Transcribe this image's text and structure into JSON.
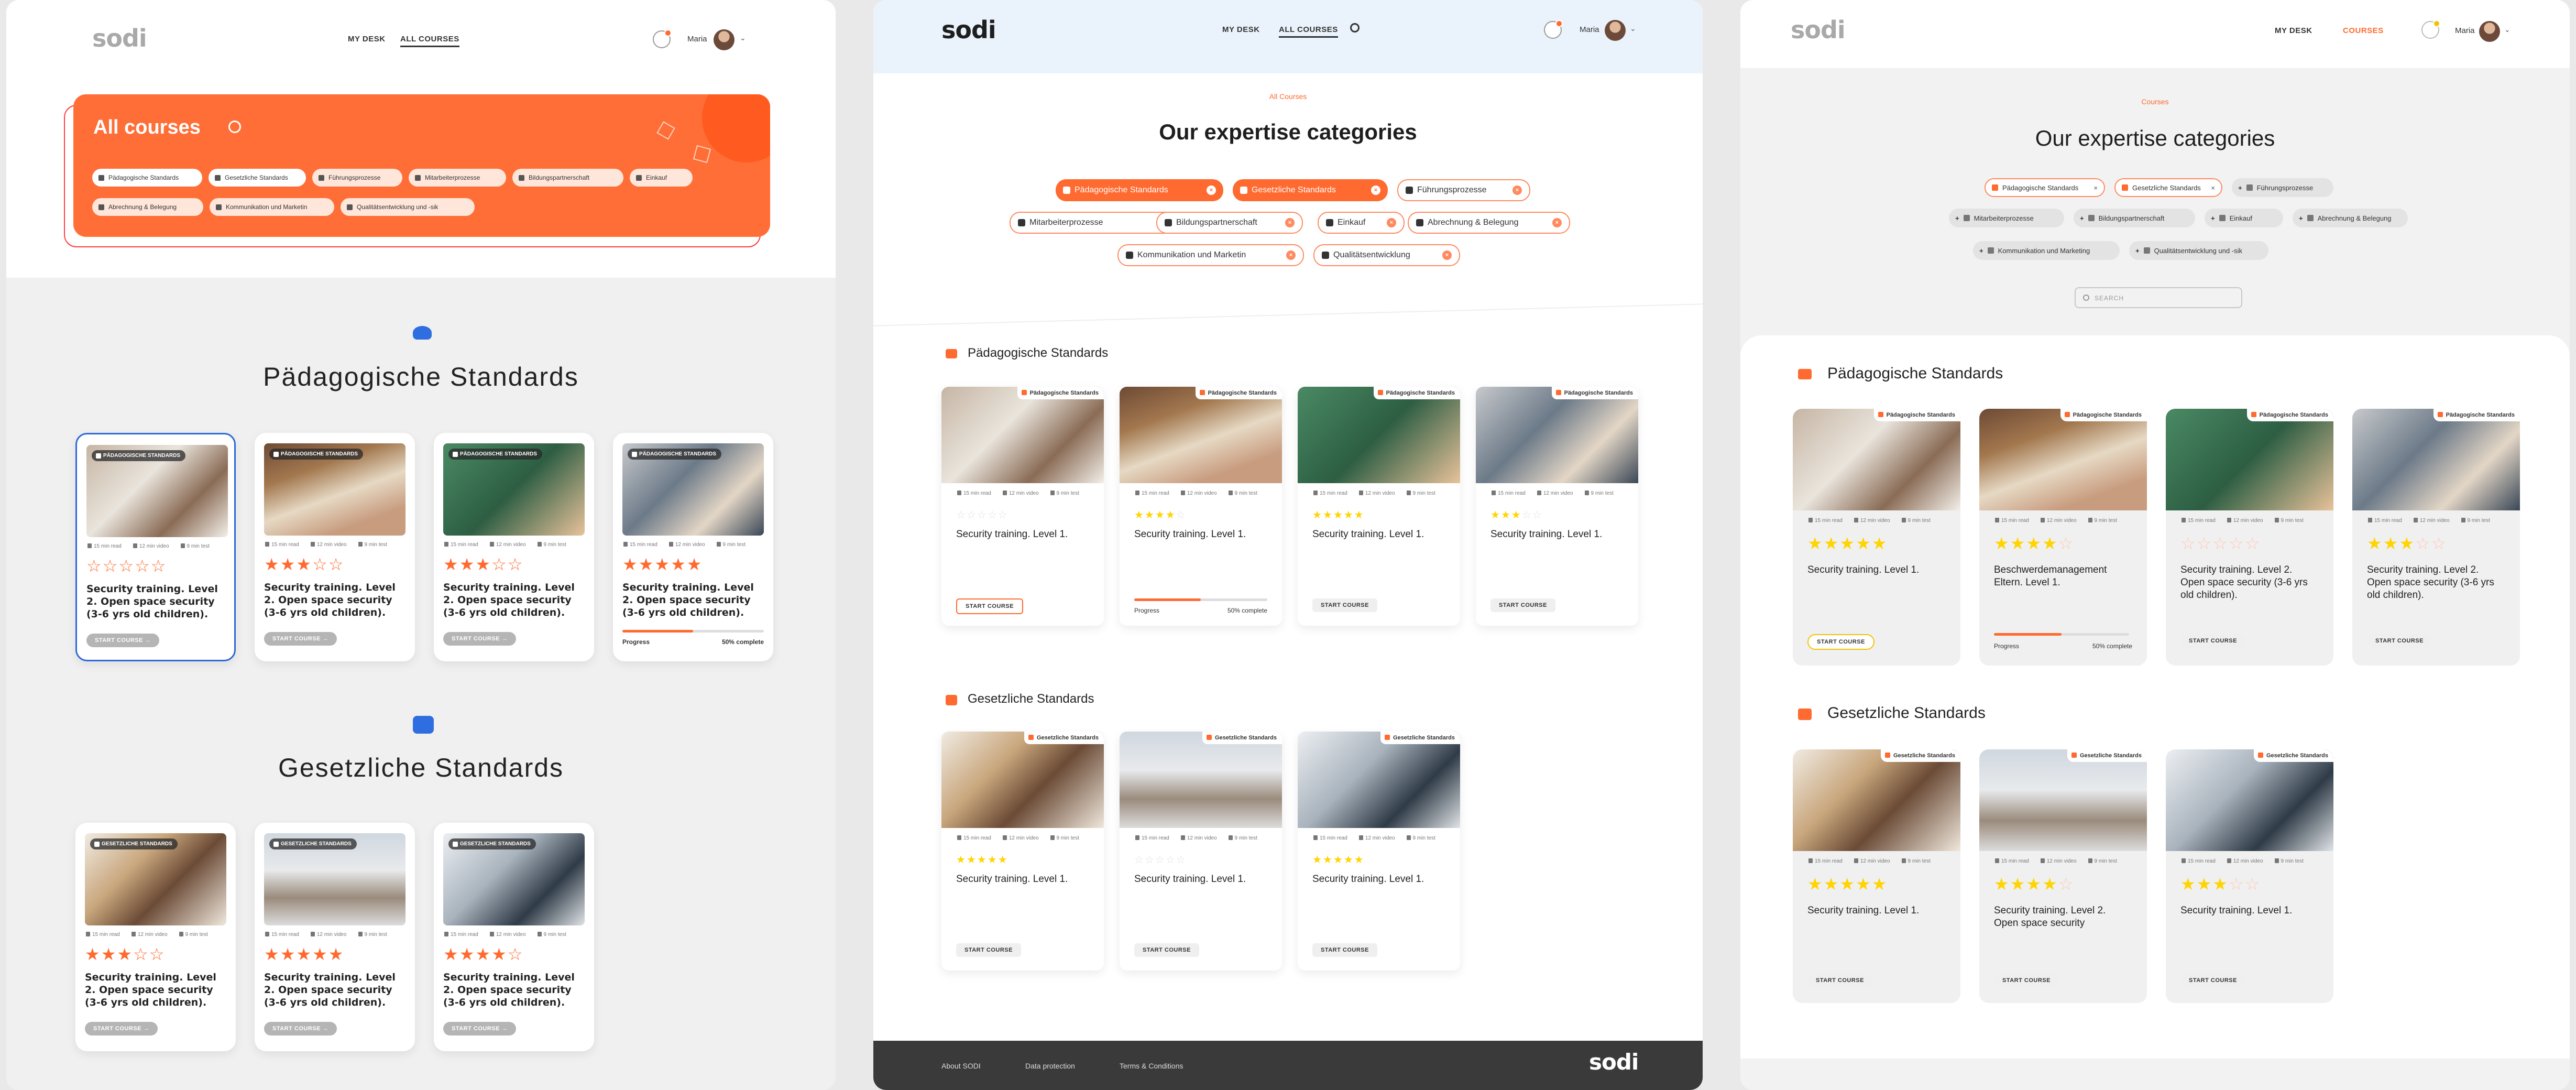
{
  "colors": {
    "accent": "#ff6a30",
    "star": "#ffd400",
    "selected": "#2d6ad8"
  },
  "panel1": {
    "logo": "sodi",
    "nav": {
      "my_desk": "MY DESK",
      "all_courses": "ALL COURSES"
    },
    "user": "Maria",
    "hero": {
      "title": "All courses",
      "chips": [
        "Pädagogische Standards",
        "Gesetzliche Standards",
        "Führungsprozesse",
        "Mitarbeiterprozesse",
        "Bildungspartnerschaft",
        "Einkauf",
        "Abrechnung & Belegung",
        "Kommunikation und Marketin",
        "Qualitätsentwicklung und -sik"
      ]
    },
    "section1": {
      "title": "Pädagogische Standards",
      "tag": "PÄDAGOGISCHE STANDARDS"
    },
    "section2": {
      "title": "Gesetzliche Standards",
      "tag": "GESETZLICHE STANDARDS"
    },
    "meta": {
      "read": "15 min read",
      "video": "12 min video",
      "test": "9 min test"
    },
    "course_title": "Security training. Level 2. Open space security (3-6 yrs old children).",
    "start": "START COURSE",
    "progress_label": "Progress",
    "progress_text": "50% complete",
    "progress_value": 0.5,
    "ratings1": [
      0,
      3,
      3,
      5
    ],
    "ratings2": [
      3,
      5,
      4
    ]
  },
  "panel2": {
    "logo": "sodi",
    "nav": {
      "my_desk": "MY DESK",
      "all_courses": "ALL COURSES"
    },
    "user": "Maria",
    "eyebrow": "All Courses",
    "heading": "Our expertise categories",
    "pills": [
      "Pädagogische Standards",
      "Gesetzliche Standards",
      "Führungsprozesse",
      "Mitarbeiterprozesse",
      "Bildungspartnerschaft",
      "Einkauf",
      "Abrechnung & Belegung",
      "Kommunikation und Marketin",
      "Qualitätsentwicklung"
    ],
    "section1": {
      "title": "Pädagogische Standards",
      "tag": "Pädagogische Standards"
    },
    "section2": {
      "title": "Gesetzliche Standards",
      "tag": "Gesetzliche Standards"
    },
    "meta": {
      "read": "15 min read",
      "video": "12 min video",
      "test": "9 min test"
    },
    "course_title": "Security training. Level 1.",
    "start": "START COURSE",
    "progress_label": "Progress",
    "progress_text": "50% complete",
    "progress_value": 0.5,
    "ratings1": [
      0,
      4,
      5,
      3
    ],
    "ratings2": [
      5,
      0,
      5
    ],
    "footer": {
      "about": "About SODI",
      "privacy": "Data protection",
      "terms": "Terms & Conditions",
      "logo": "sodi"
    }
  },
  "panel3": {
    "logo": "sodi",
    "nav": {
      "my_desk": "MY DESK",
      "courses": "COURSES"
    },
    "user": "Maria",
    "eyebrow": "Courses",
    "heading": "Our expertise categories",
    "pills": [
      "Pädagogische Standards",
      "Gesetzliche Standards",
      "Führungsprozesse",
      "Mitarbeiterprozesse",
      "Bildungspartnerschaft",
      "Einkauf",
      "Abrechnung & Belegung",
      "Kommunikation und Marketing",
      "Qualitätsentwicklung und -sik"
    ],
    "search_placeholder": "SEARCH",
    "section1": {
      "title": "Pädagogische Standards",
      "tag": "Pädagogische Standards"
    },
    "section2": {
      "title": "Gesetzliche Standards",
      "tag": "Gesetzliche Standards"
    },
    "meta": {
      "read": "15 min read",
      "video": "12 min video",
      "test": "9 min test"
    },
    "titles1": [
      "Security training. Level 1.",
      "Beschwerdemanagement Eltern. Level 1.",
      "Security training. Level 2. Open space security (3-6 yrs old children).",
      "Security training. Level 2. Open space security (3-6 yrs old children)."
    ],
    "titles2": [
      "Security training. Level 1.",
      "Security training. Level 2. Open space security",
      "Security training. Level 1."
    ],
    "start": "START COURSE",
    "progress_label": "Progress",
    "progress_text": "50% complete",
    "progress_value": 0.5,
    "ratings1": [
      5,
      4,
      0,
      3
    ],
    "ratings2": [
      5,
      4,
      3
    ]
  }
}
